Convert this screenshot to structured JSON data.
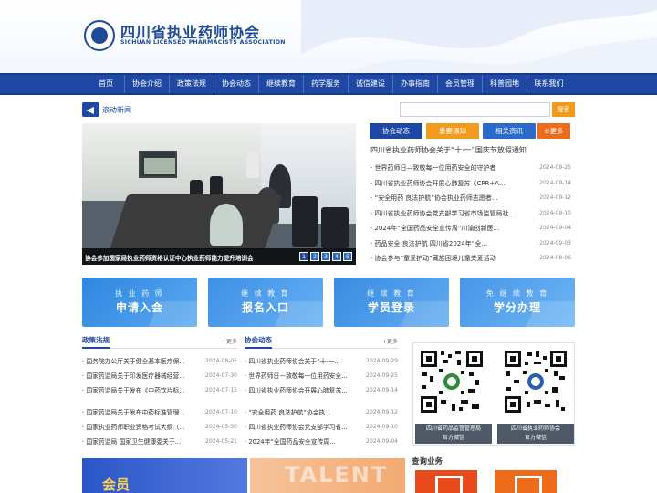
{
  "header": {
    "title_cn": "四川省执业药师协会",
    "title_en": "SICHUAN LICENSED PHARMACISTS ASSOCIATION"
  },
  "nav": {
    "items": [
      "首页",
      "协会介绍",
      "政策法规",
      "协会动态",
      "继续教育",
      "药学服务",
      "诚信建设",
      "办事指南",
      "会员管理",
      "科普园地",
      "联系我们"
    ]
  },
  "ticker": {
    "label": "滚动新闻",
    "search_button": "搜索"
  },
  "slideshow": {
    "caption": "协会参加国家局执业药师资格认证中心执业药师能力提升培训会",
    "pages": [
      "1",
      "2",
      "3",
      "4",
      "5"
    ]
  },
  "tabs": {
    "items": [
      "协会动态",
      "重要通知",
      "相关资讯"
    ],
    "more": "更多"
  },
  "headline": "四川省执业药师协会关于“十·一”国庆节放假通知",
  "news": [
    {
      "title": "· 世界药师日—致敬每一位用药安全的守护者",
      "date": "2024-09-25"
    },
    {
      "title": "· 四川省执业药师协会开展心肺复苏（CPR+A...",
      "date": "2024-09-14"
    },
    {
      "title": "· “安全用药 良法护航”协会执业药师志愿者...",
      "date": "2024-09-12"
    },
    {
      "title": "· 四川省执业药师协会党支部学习省市场监管局社...",
      "date": "2024-09-10"
    },
    {
      "title": "· 2024年“全国药品安全宣传周”川渝创新医...",
      "date": "2024-09-04"
    },
    {
      "title": "· 药品安全 良法护航 四川省2024年“全...",
      "date": "2024-09-03"
    },
    {
      "title": "· 协会参与“童爱护动”藏族困境儿童关爱活动",
      "date": "2024-08-06"
    }
  ],
  "banners": [
    {
      "line1": "执 业 药 师",
      "line2": "申请入会",
      "color": "#2f86e0"
    },
    {
      "line1": "继 续 教 育",
      "line2": "报名入口",
      "color": "#3f90e6"
    },
    {
      "line1": "继 续 教 育",
      "line2": "学员登录",
      "color": "#3a8be2"
    },
    {
      "line1": "免 继 续 教 育",
      "line2": "学分办理",
      "color": "#4796e8"
    }
  ],
  "policy": {
    "title": "政策法规",
    "more": "+更多",
    "items": [
      {
        "title": "· 国务院办公厅关于健全基本医疗保...",
        "date": "2024-08-05"
      },
      {
        "title": "· 国家药监局关于印发医疗器械经营...",
        "date": "2024-07-30"
      },
      {
        "title": "· 国家药监局关于发布《中药饮片标...",
        "date": "2024-07-15"
      },
      {
        "title": "· 国家药监局关于发布中药标准管理...",
        "date": "2024-07-10"
      },
      {
        "title": "· 国家执业药师职业资格考试大纲（...",
        "date": "2024-05-30"
      },
      {
        "title": "· 国家药监局 国家卫生健康委关于...",
        "date": "2024-05-21"
      }
    ]
  },
  "dynamics": {
    "title": "协会动态",
    "more": "+更多",
    "items": [
      {
        "title": "· 四川省执业药师协会关于“十·一...",
        "date": "2024-09-29"
      },
      {
        "title": "· 世界药师日—致敬每一位用药安全...",
        "date": "2024-09-25"
      },
      {
        "title": "· 四川省执业药师协会开展心肺复苏...",
        "date": "2024-09-14"
      },
      {
        "title": "· “安全用药 良法护航”协会执...",
        "date": "2024-09-12"
      },
      {
        "title": "· 四川省执业药师协会党支部学习省...",
        "date": "2024-09-10"
      },
      {
        "title": "· 2024年“全国药品安全宣传周...",
        "date": "2024-09-04"
      }
    ]
  },
  "qrcodes": [
    {
      "line1": "四川省药品监督管理局",
      "line2": "官方微信"
    },
    {
      "line1": "四川省执业药师协会",
      "line2": "官方微信"
    }
  ],
  "query": {
    "title": "查询业务"
  },
  "bottom": {
    "banner1": "会员",
    "banner2": "TALENT"
  }
}
